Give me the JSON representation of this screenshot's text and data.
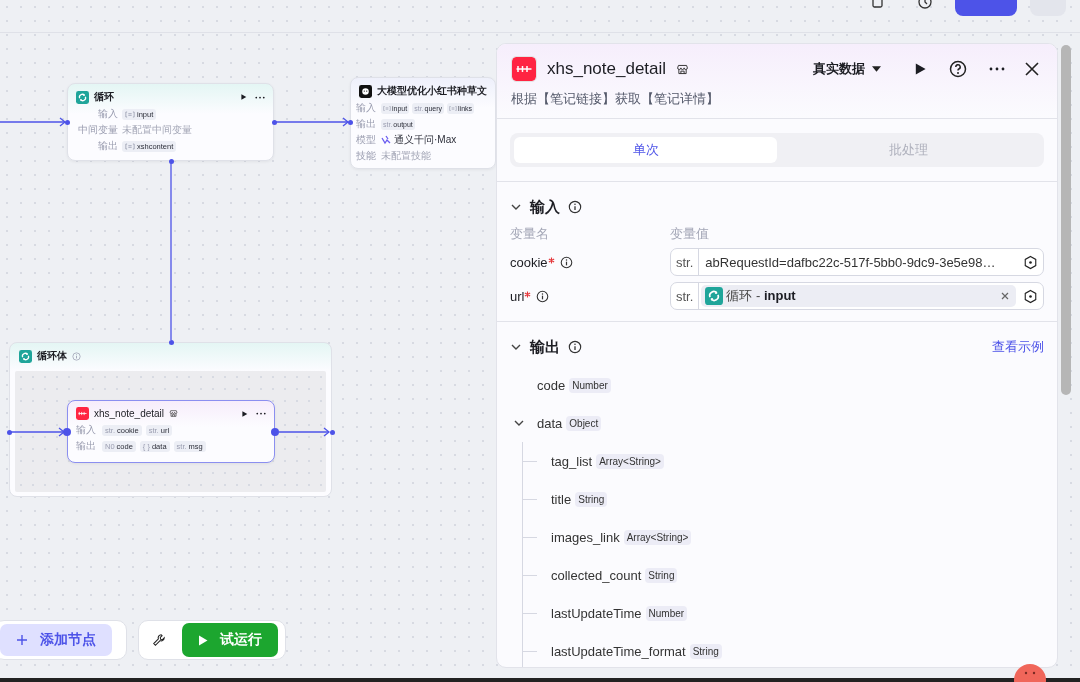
{
  "canvas": {
    "nodes": [
      {
        "kind": "loop",
        "title": "循环",
        "rows": [
          {
            "kind": "tags",
            "label": "输入",
            "tags": [
              {
                "kind": "array",
                "name": "input"
              }
            ]
          },
          {
            "kind": "text",
            "label": "中间变量",
            "text": "未配置中间变量"
          },
          {
            "kind": "tags",
            "label": "输出",
            "tags": [
              {
                "kind": "array",
                "name": "xshcontent"
              }
            ]
          }
        ]
      },
      {
        "kind": "llm",
        "title": "大模型优化小红书种草文",
        "rows": [
          {
            "kind": "tags",
            "label": "输入",
            "tags": [
              {
                "kind": "array",
                "name": "input"
              },
              {
                "kind": "str",
                "prefix": "str.",
                "name": "query"
              },
              {
                "kind": "array",
                "name": "links"
              }
            ]
          },
          {
            "kind": "tags",
            "label": "输出",
            "tags": [
              {
                "kind": "str",
                "prefix": "str.",
                "name": "output"
              }
            ]
          },
          {
            "kind": "model",
            "label": "模型",
            "text": "通义千问·Max"
          },
          {
            "kind": "text",
            "label": "技能",
            "text": "未配置技能"
          }
        ]
      },
      {
        "kind": "plugin",
        "title": "xhs_note_detail",
        "rows": [
          {
            "kind": "tags",
            "label": "输入",
            "tags": [
              {
                "kind": "str",
                "prefix": "str.",
                "name": "cookie"
              },
              {
                "kind": "str",
                "prefix": "str.",
                "name": "url"
              }
            ]
          },
          {
            "kind": "tags",
            "label": "输出",
            "tags": [
              {
                "kind": "num",
                "prefix": "N0",
                "name": "code"
              },
              {
                "kind": "obj",
                "prefix": "{ }",
                "name": "data"
              },
              {
                "kind": "str",
                "prefix": "str.",
                "name": "msg"
              }
            ]
          }
        ]
      }
    ],
    "loop_body": {
      "title": "循环体"
    },
    "bottom_toolbar": {
      "add_node": "添加节点",
      "test_run": "试运行"
    }
  },
  "panel": {
    "title": "xhs_note_detail",
    "data_mode": "真实数据",
    "description": "根据【笔记链接】获取【笔记详情】",
    "tabs": [
      {
        "label": "单次",
        "selected": true
      },
      {
        "label": "批处理",
        "selected": false
      }
    ],
    "input": {
      "title": "输入",
      "expanded": true,
      "name_header": "变量名",
      "value_header": "变量值",
      "params": [
        {
          "name": "cookie",
          "required": true,
          "type": "str.",
          "kind": "text",
          "value": "abRequestId=dafbc22c-517f-5bb0-9dc9-3e5e98…"
        },
        {
          "name": "url",
          "required": true,
          "type": "str.",
          "kind": "reference",
          "value": "循环 - **input**"
        }
      ]
    },
    "output": {
      "title": "输出",
      "expanded": true,
      "example_link": "查看示例",
      "fields": [
        {
          "name": "code",
          "type": "Number"
        },
        {
          "name": "data",
          "type": "Object",
          "expanded": true,
          "children": [
            {
              "name": "tag_list",
              "type": "Array<String>"
            },
            {
              "name": "title",
              "type": "String"
            },
            {
              "name": "images_link",
              "type": "Array<String>"
            },
            {
              "name": "collected_count",
              "type": "String"
            },
            {
              "name": "lastUpdateTime",
              "type": "Number"
            },
            {
              "name": "lastUpdateTime_format",
              "type": "String"
            }
          ]
        }
      ]
    }
  }
}
